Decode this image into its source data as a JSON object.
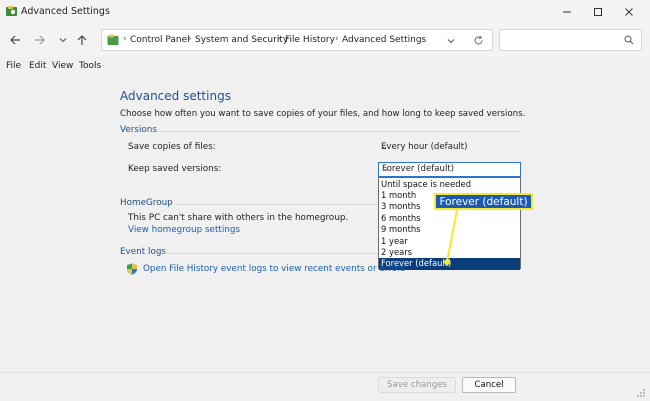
{
  "window": {
    "title": "Advanced Settings",
    "controls": {
      "minimize": "minimize-icon",
      "maximize": "maximize-icon",
      "close": "close-icon"
    }
  },
  "nav": {
    "back_icon": "arrow-left-icon",
    "forward_icon": "arrow-right-icon",
    "recent_icon": "chevron-down-icon",
    "up_icon": "arrow-up-icon",
    "breadcrumb": [
      "Control Panel",
      "System and Security",
      "File History",
      "Advanced Settings"
    ],
    "search_placeholder": ""
  },
  "menu": [
    "File",
    "Edit",
    "View",
    "Tools"
  ],
  "main": {
    "title": "Advanced settings",
    "description": "Choose how often you want to save copies of your files, and how long to keep saved versions.",
    "versions": {
      "section": "Versions",
      "save_copies_label": "Save copies of files:",
      "save_copies_value": "Every hour (default)",
      "keep_label": "Keep saved versions:",
      "keep_value": "Forever (default)",
      "keep_options": [
        "Until space is needed",
        "1 month",
        "3 months",
        "6 months",
        "9 months",
        "1 year",
        "2 years",
        "Forever (default)"
      ],
      "selected_index": 7
    },
    "homegroup": {
      "section": "HomeGroup",
      "text": "This PC can't share with others in the homegroup.",
      "link": "View homegroup settings"
    },
    "event_logs": {
      "section": "Event logs",
      "link": "Open File History event logs to view recent events or errors"
    },
    "callout": "Forever (default)"
  },
  "footer": {
    "save": "Save changes",
    "cancel": "Cancel"
  },
  "colors": {
    "accent": "#1e4e8c",
    "link": "#1a5fb4",
    "selection": "#0b3d7a",
    "callout_bg": "#1d5bb3",
    "callout_border": "#f3ea2c"
  }
}
